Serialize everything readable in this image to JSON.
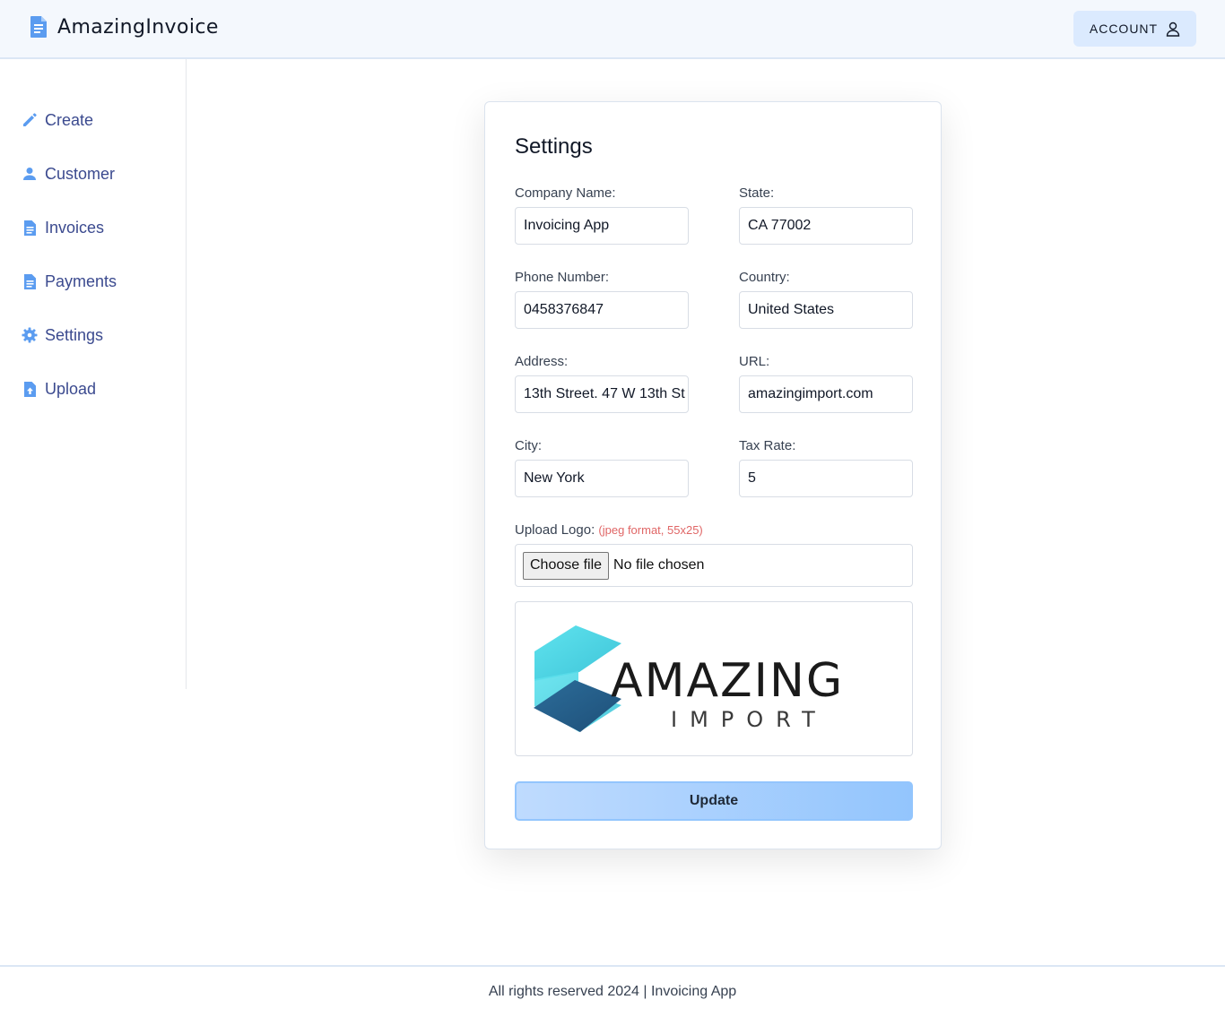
{
  "header": {
    "brand_icon": "document-icon",
    "brand_name": "AmazingInvoice",
    "account_label": "ACCOUNT",
    "account_icon": "user-icon"
  },
  "sidebar": {
    "items": [
      {
        "label": "Create",
        "icon": "pencil-icon"
      },
      {
        "label": "Customer",
        "icon": "user-icon"
      },
      {
        "label": "Invoices",
        "icon": "document-icon"
      },
      {
        "label": "Payments",
        "icon": "document-icon"
      },
      {
        "label": "Settings",
        "icon": "gear-icon"
      },
      {
        "label": "Upload",
        "icon": "upload-icon"
      }
    ]
  },
  "settings": {
    "title": "Settings",
    "fields": {
      "company_name": {
        "label": "Company Name:",
        "value": "Invoicing App"
      },
      "state": {
        "label": "State:",
        "value": "CA 77002"
      },
      "phone": {
        "label": "Phone Number:",
        "value": "0458376847"
      },
      "country": {
        "label": "Country:",
        "value": "United States"
      },
      "address": {
        "label": "Address:",
        "value": "13th Street. 47 W 13th St"
      },
      "url": {
        "label": "URL:",
        "value": "amazingimport.com"
      },
      "city": {
        "label": "City:",
        "value": "New York"
      },
      "tax_rate": {
        "label": "Tax Rate:",
        "value": "5"
      }
    },
    "upload": {
      "label": "Upload Logo:",
      "hint": "(jpeg format, 55x25)",
      "button": "Choose file",
      "status": "No file chosen"
    },
    "logo": {
      "word1": "AMAZING",
      "word2": "IMPORT"
    },
    "update_label": "Update"
  },
  "footer": {
    "text": "All rights reserved 2024 | Invoicing App"
  },
  "colors": {
    "accent": "#3b82f6",
    "nav_text": "#3b4a8f",
    "button_light": "#bfdbfe",
    "button_dark": "#93c5fd",
    "hint": "#e06666"
  }
}
